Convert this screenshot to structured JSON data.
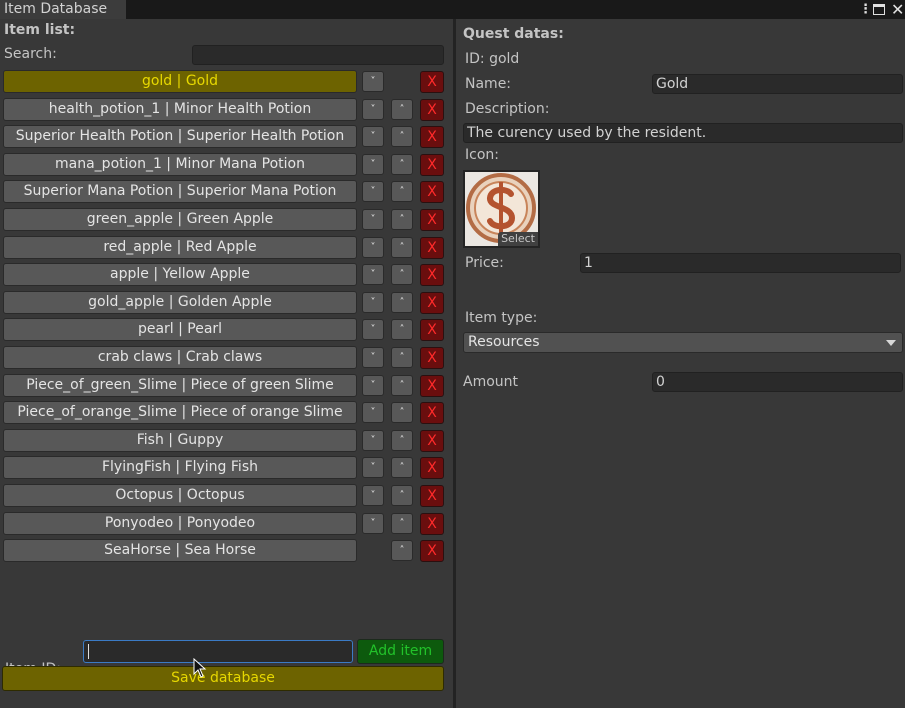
{
  "window": {
    "tab_title": "Item Database",
    "menu_icon": "kebab-menu-icon",
    "maximize_icon": "maximize-icon",
    "close_icon": "close-icon"
  },
  "left": {
    "heading": "Item list:",
    "search_label": "Search:",
    "search_value": "",
    "items": [
      {
        "label": "gold | Gold",
        "selected": true,
        "down": true,
        "up": false
      },
      {
        "label": "health_potion_1 | Minor Health Potion",
        "down": true,
        "up": true
      },
      {
        "label": "Superior Health Potion | Superior Health Potion",
        "down": true,
        "up": true
      },
      {
        "label": "mana_potion_1 | Minor Mana Potion",
        "down": true,
        "up": true
      },
      {
        "label": "Superior Mana Potion | Superior Mana Potion",
        "down": true,
        "up": true
      },
      {
        "label": "green_apple | Green Apple",
        "down": true,
        "up": true
      },
      {
        "label": "red_apple | Red Apple",
        "down": true,
        "up": true
      },
      {
        "label": "apple | Yellow Apple",
        "down": true,
        "up": true
      },
      {
        "label": "gold_apple | Golden Apple",
        "down": true,
        "up": true
      },
      {
        "label": "pearl | Pearl",
        "down": true,
        "up": true
      },
      {
        "label": "crab claws | Crab claws",
        "down": true,
        "up": true
      },
      {
        "label": "Piece_of_green_Slime | Piece of green Slime",
        "down": true,
        "up": true
      },
      {
        "label": "Piece_of_orange_Slime | Piece of orange Slime",
        "down": true,
        "up": true
      },
      {
        "label": "Fish | Guppy",
        "down": true,
        "up": true
      },
      {
        "label": "FlyingFish | Flying Fish",
        "down": true,
        "up": true
      },
      {
        "label": "Octopus | Octopus",
        "down": true,
        "up": true
      },
      {
        "label": "Ponyodeo | Ponyodeo",
        "down": true,
        "up": true
      },
      {
        "label": "SeaHorse | Sea Horse",
        "down": false,
        "up": true
      }
    ],
    "down_glyph": "˅",
    "up_glyph": "˄",
    "delete_glyph": "X",
    "item_id_label": "Item ID:",
    "item_id_value": "",
    "add_button": "Add item",
    "save_button": "Save database"
  },
  "right": {
    "heading": "Quest datas:",
    "id_line": "ID: gold",
    "name_label": "Name:",
    "name_value": "Gold",
    "description_label": "Description:",
    "description_value": "The curency used by the resident.",
    "icon_label": "Icon:",
    "icon_name": "gold-coin-dollar-icon",
    "icon_select": "Select",
    "price_label": "Price:",
    "price_value": "1",
    "item_type_label": "Item type:",
    "item_type_value": "Resources",
    "amount_label": "Amount",
    "amount_value": "0"
  },
  "colors": {
    "selected_item_bg": "#6d6300",
    "selected_item_text": "#e8d900",
    "delete_bg": "#6a0e0e",
    "delete_text": "#ff2a2a",
    "add_bg": "#0d5a0d",
    "add_text": "#22c22a",
    "focus_border": "#3b7bc5"
  }
}
